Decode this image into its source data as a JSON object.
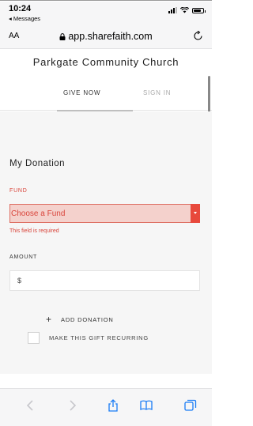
{
  "status_bar": {
    "time": "10:24",
    "back_app": "◂ Messages"
  },
  "browser": {
    "text_size_label": "AA",
    "url": "app.sharefaith.com",
    "icons": [
      "lock-icon",
      "reload-icon",
      "back-arrow-icon",
      "forward-arrow-icon",
      "share-icon",
      "bookmarks-icon",
      "tabs-icon"
    ]
  },
  "page": {
    "church_name": "Parkgate Community Church",
    "tabs": [
      {
        "label": "GIVE NOW",
        "active": true
      },
      {
        "label": "SIGN IN",
        "active": false
      }
    ],
    "section_title": "My Donation",
    "fund": {
      "label": "FUND",
      "value": "Choose a Fund",
      "error": "This field is required"
    },
    "amount": {
      "label": "AMOUNT",
      "prefix": "$",
      "value": ""
    },
    "add_donation_label": "ADD DONATION",
    "recurring": {
      "label": "MAKE THIS GIFT RECURRING",
      "checked": false
    }
  },
  "colors": {
    "error": "#d9443a",
    "select_bg": "#f4d1cc",
    "select_arrow": "#e8493c",
    "form_bg": "#f6f6f6"
  }
}
